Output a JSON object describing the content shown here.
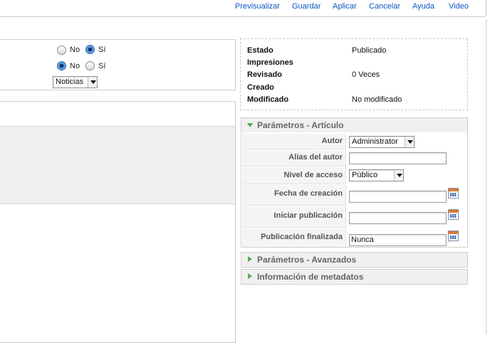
{
  "toolbar": {
    "buttons": [
      "Previsualizar",
      "Guardar",
      "Aplicar",
      "Cancelar",
      "Ayuda",
      "Video"
    ]
  },
  "form": {
    "radio_no": "No",
    "radio_si": "Sí",
    "row1_selected": "Sí",
    "row2_selected": "No",
    "section_select": "Noticias"
  },
  "info": {
    "estado_label": "Estado",
    "estado_value": "Publicado",
    "impresiones_label": "Impresiones",
    "revisado_label": "Revisado",
    "revisado_value": "0 Veces",
    "creado_label": "Creado",
    "modificado_label": "Modificado",
    "modificado_value": "No modificado"
  },
  "params": {
    "title": "Parámetros - Artículo",
    "autor_label": "Autor",
    "autor_value": "Administrator",
    "alias_label": "Alias del autor",
    "alias_value": "",
    "nivel_label": "Nivel de acceso",
    "nivel_value": "Público",
    "fecha_label": "Fecha de creación",
    "fecha_value": "",
    "iniciar_label": "Iniciar publicación",
    "iniciar_value": "",
    "finalizada_label": "Publicación finalizada",
    "finalizada_value": "Nunca"
  },
  "advanced": {
    "title": "Parámetros - Avanzados"
  },
  "metadata": {
    "title": "Información de metadatos"
  },
  "colors": {
    "link": "#0b55c4",
    "accordion_arrow": "#4fae45",
    "accordion_bg": "#f0f0f0"
  }
}
